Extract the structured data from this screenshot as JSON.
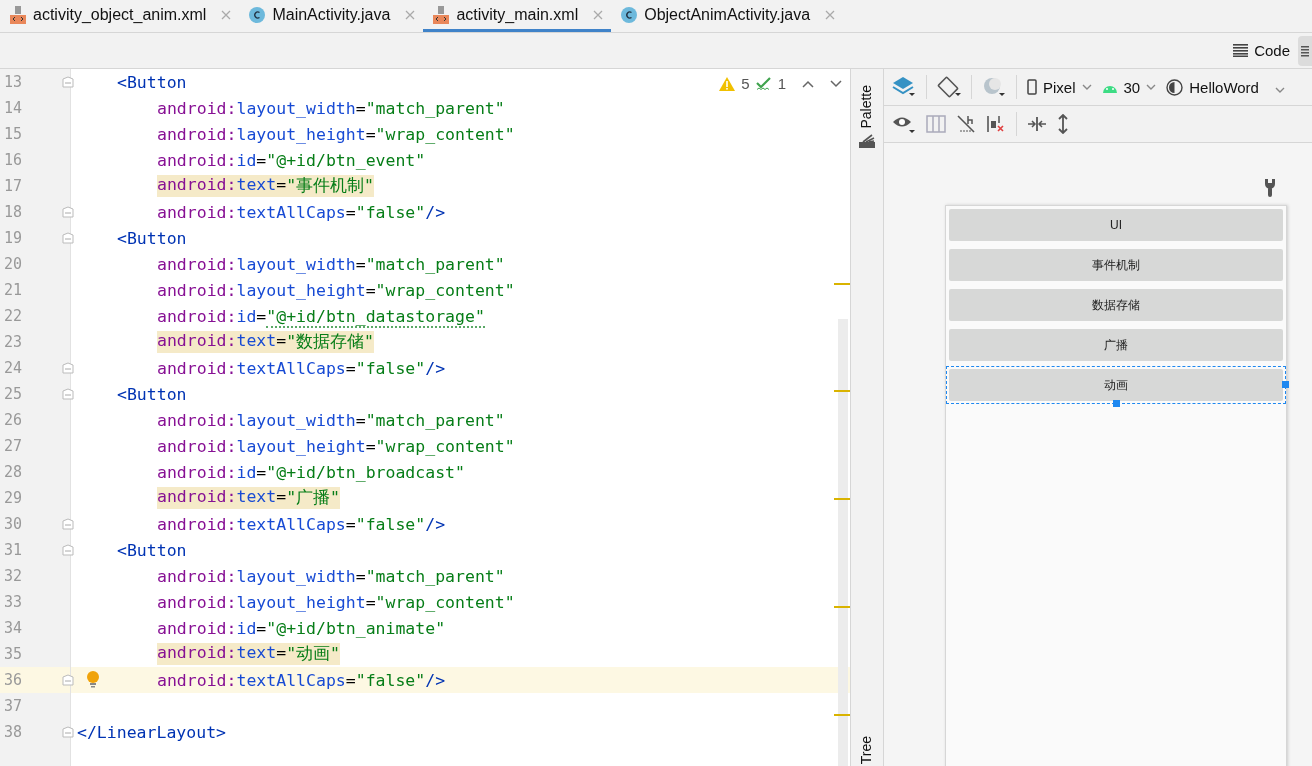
{
  "tabs": [
    {
      "label": "activity_object_anim.xml",
      "kind": "xml",
      "selected": false
    },
    {
      "label": "MainActivity.java",
      "kind": "java",
      "selected": false
    },
    {
      "label": "activity_main.xml",
      "kind": "xml",
      "selected": true
    },
    {
      "label": "ObjectAnimActivity.java",
      "kind": "java",
      "selected": false
    }
  ],
  "view_mode": {
    "label": "Code"
  },
  "inspections": {
    "warnings": "5",
    "typos": "1"
  },
  "editor": {
    "lines": [
      {
        "number": "13",
        "kind": "element",
        "text": "<Button"
      },
      {
        "number": "14",
        "kind": "attribute",
        "ns": "android:",
        "name": "layout_width",
        "sign": "=",
        "value": "\"match_parent\"",
        "highlighted": false,
        "current": false
      },
      {
        "number": "15",
        "kind": "attribute",
        "ns": "android:",
        "name": "layout_height",
        "sign": "=",
        "value": "\"wrap_content\"",
        "highlighted": false,
        "current": false
      },
      {
        "number": "16",
        "kind": "attribute",
        "ns": "android:",
        "name": "id",
        "sign": "=",
        "value": "\"@+id/btn_event\"",
        "highlighted": false,
        "current": false
      },
      {
        "number": "17",
        "kind": "attribute",
        "ns": "android:",
        "name": "text",
        "sign": "=",
        "value": "\"事件机制\"",
        "highlighted": true,
        "current": false
      },
      {
        "number": "18",
        "kind": "attribute",
        "ns": "android:",
        "name": "textAllCaps",
        "sign": "=",
        "value": "\"false\"",
        "end": "/>",
        "highlighted": false,
        "current": false
      },
      {
        "number": "19",
        "kind": "element",
        "text": "<Button"
      },
      {
        "number": "20",
        "kind": "attribute",
        "ns": "android:",
        "name": "layout_width",
        "sign": "=",
        "value": "\"match_parent\"",
        "highlighted": false,
        "current": false
      },
      {
        "number": "21",
        "kind": "attribute",
        "ns": "android:",
        "name": "layout_height",
        "sign": "=",
        "value": "\"wrap_content\"",
        "highlighted": false,
        "current": false
      },
      {
        "number": "22",
        "kind": "attribute",
        "ns": "android:",
        "name": "id",
        "sign": "=",
        "value": "\"@+id/btn_datastorage\"",
        "highlighted": false,
        "typo": true,
        "current": false
      },
      {
        "number": "23",
        "kind": "attribute",
        "ns": "android:",
        "name": "text",
        "sign": "=",
        "value": "\"数据存储\"",
        "highlighted": true,
        "current": false
      },
      {
        "number": "24",
        "kind": "attribute",
        "ns": "android:",
        "name": "textAllCaps",
        "sign": "=",
        "value": "\"false\"",
        "end": "/>",
        "highlighted": false,
        "current": false
      },
      {
        "number": "25",
        "kind": "element",
        "text": "<Button"
      },
      {
        "number": "26",
        "kind": "attribute",
        "ns": "android:",
        "name": "layout_width",
        "sign": "=",
        "value": "\"match_parent\"",
        "highlighted": false,
        "current": false
      },
      {
        "number": "27",
        "kind": "attribute",
        "ns": "android:",
        "name": "layout_height",
        "sign": "=",
        "value": "\"wrap_content\"",
        "highlighted": false,
        "current": false
      },
      {
        "number": "28",
        "kind": "attribute",
        "ns": "android:",
        "name": "id",
        "sign": "=",
        "value": "\"@+id/btn_broadcast\"",
        "highlighted": false,
        "current": false
      },
      {
        "number": "29",
        "kind": "attribute",
        "ns": "android:",
        "name": "text",
        "sign": "=",
        "value": "\"广播\"",
        "highlighted": true,
        "current": false
      },
      {
        "number": "30",
        "kind": "attribute",
        "ns": "android:",
        "name": "textAllCaps",
        "sign": "=",
        "value": "\"false\"",
        "end": "/>",
        "highlighted": false,
        "current": false
      },
      {
        "number": "31",
        "kind": "element",
        "text": "<Button"
      },
      {
        "number": "32",
        "kind": "attribute",
        "ns": "android:",
        "name": "layout_width",
        "sign": "=",
        "value": "\"match_parent\"",
        "highlighted": false,
        "current": false
      },
      {
        "number": "33",
        "kind": "attribute",
        "ns": "android:",
        "name": "layout_height",
        "sign": "=",
        "value": "\"wrap_content\"",
        "highlighted": false,
        "current": false
      },
      {
        "number": "34",
        "kind": "attribute",
        "ns": "android:",
        "name": "id",
        "sign": "=",
        "value": "\"@+id/btn_animate\"",
        "highlighted": false,
        "current": false
      },
      {
        "number": "35",
        "kind": "attribute",
        "ns": "android:",
        "name": "text",
        "sign": "=",
        "value": "\"动画\"",
        "highlighted": true,
        "current": false
      },
      {
        "number": "36",
        "kind": "attribute",
        "ns": "android:",
        "name": "textAllCaps",
        "sign": "=",
        "value": "\"false\"",
        "end": "/>",
        "highlighted": false,
        "current": true
      },
      {
        "number": "37",
        "kind": "blank"
      },
      {
        "number": "38",
        "kind": "close",
        "text": "</LinearLayout>"
      }
    ]
  },
  "side_strip": {
    "top": "Palette",
    "bottom": "Tree"
  },
  "design_toolbar": {
    "device": "Pixel",
    "api": "30",
    "theme": "HelloWord"
  },
  "preview": {
    "buttons": [
      {
        "label": "UI",
        "selected": false
      },
      {
        "label": "事件机制",
        "selected": false
      },
      {
        "label": "数据存储",
        "selected": false
      },
      {
        "label": "广播",
        "selected": false
      },
      {
        "label": "动画",
        "selected": true
      }
    ]
  }
}
